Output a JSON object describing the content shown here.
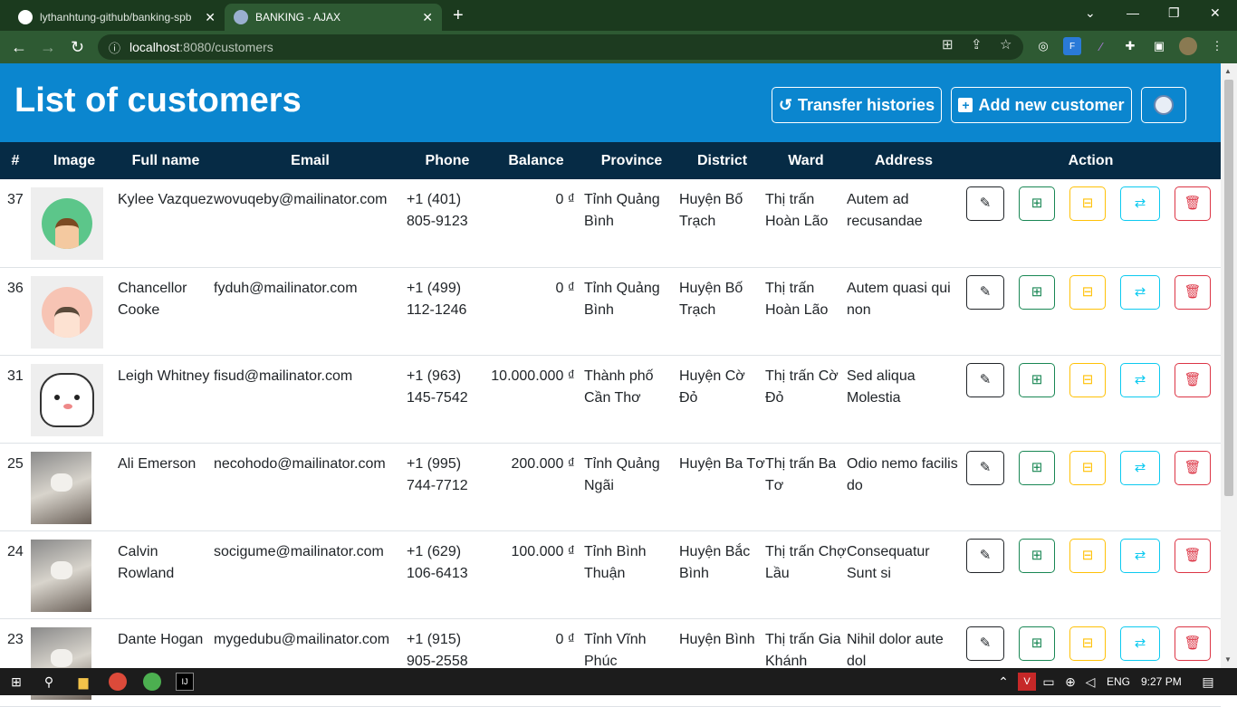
{
  "browser": {
    "tabs": [
      {
        "title": "lythanhtung-github/banking-spb",
        "icon": "github-icon"
      },
      {
        "title": "BANKING - AJAX",
        "icon": "bear-icon"
      }
    ],
    "url_host": "localhost",
    "url_path": ":8080/customers"
  },
  "page": {
    "title": "List of customers",
    "transfer_label": "Transfer histories",
    "add_label": "Add new customer"
  },
  "table": {
    "headers": [
      "#",
      "Image",
      "Full name",
      "Email",
      "Phone",
      "Balance",
      "Province",
      "District",
      "Ward",
      "Address",
      "Action"
    ],
    "rows": [
      {
        "id": "37",
        "name": "Kylee Vazquez",
        "email": "wovuqeby@mailinator.com",
        "phone": "+1 (401) 805-9123",
        "balance": "0 ₫",
        "province": "Tỉnh Quảng Bình",
        "district": "Huyện Bố Trạch",
        "ward": "Thị trấn Hoàn Lão",
        "address": "Autem ad recusandae",
        "image": "avatar-man"
      },
      {
        "id": "36",
        "name": "Chancellor Cooke",
        "email": "fyduh@mailinator.com",
        "phone": "+1 (499) 112-1246",
        "balance": "0 ₫",
        "province": "Tỉnh Quảng Bình",
        "district": "Huyện Bố Trạch",
        "ward": "Thị trấn Hoàn Lão",
        "address": "Autem quasi qui non",
        "image": "avatar-glasses"
      },
      {
        "id": "31",
        "name": "Leigh Whitney",
        "email": "fisud@mailinator.com",
        "phone": "+1 (963) 145-7542",
        "balance": "10.000.000 ₫",
        "province": "Thành phố Cần Thơ",
        "district": "Huyện Cờ Đỏ",
        "ward": "Thị trấn Cờ Đỏ",
        "address": "Sed aliqua Molestia",
        "image": "cartoon-bear"
      },
      {
        "id": "25",
        "name": "Ali Emerson",
        "email": "necohodo@mailinator.com",
        "phone": "+1 (995) 744-7712",
        "balance": "200.000 ₫",
        "province": "Tỉnh Quảng Ngãi",
        "district": "Huyện Ba Tơ",
        "ward": "Thị trấn Ba Tơ",
        "address": "Odio nemo facilis do",
        "image": "cat-photo"
      },
      {
        "id": "24",
        "name": "Calvin Rowland",
        "email": "socigume@mailinator.com",
        "phone": "+1 (629) 106-6413",
        "balance": "100.000 ₫",
        "province": "Tỉnh Bình Thuận",
        "district": "Huyện Bắc Bình",
        "ward": "Thị trấn Chợ Lầu",
        "address": "Consequatur Sunt si",
        "image": "cat-photo"
      },
      {
        "id": "23",
        "name": "Dante Hogan",
        "email": "mygedubu@mailinator.com",
        "phone": "+1 (915) 905-2558",
        "balance": "0 ₫",
        "province": "Tỉnh Vĩnh Phúc",
        "district": "Huyện Bình",
        "ward": "Thị trấn Gia Khánh",
        "address": "Nihil dolor aute dol",
        "image": "cat-photo"
      }
    ]
  },
  "taskbar": {
    "lang": "ENG",
    "time": "9:27 PM"
  },
  "colors": {
    "header_bg": "#0b86cf",
    "table_head_bg": "#062b45",
    "edit": "#212529",
    "deposit": "#198754",
    "withdraw": "#ffc107",
    "transfer": "#0dcaf0",
    "delete": "#dc3545"
  }
}
